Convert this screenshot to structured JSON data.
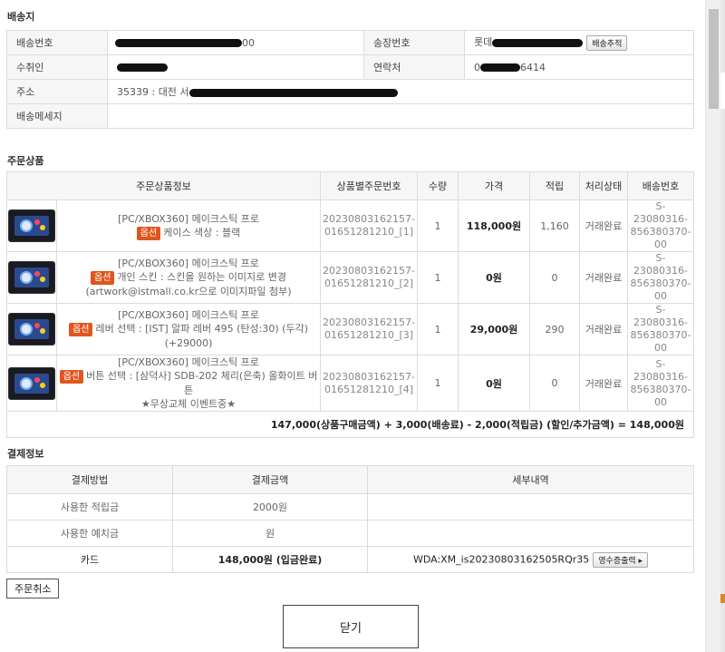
{
  "shipping": {
    "title": "배송지",
    "delivery_no_label": "배송번호",
    "delivery_no_suffix": "00",
    "invoice_label": "송장번호",
    "invoice_prefix": "롯데",
    "track_button": "배송추적",
    "recipient_label": "수취인",
    "contact_label": "연락처",
    "contact_prefix": "0",
    "contact_suffix": "6414",
    "address_label": "주소",
    "address_value": "35339 : 대전 서",
    "message_label": "배송메세지",
    "message_value": ""
  },
  "order": {
    "title": "주문상품",
    "headers": [
      "주문상품정보",
      "상품별주문번호",
      "수량",
      "가격",
      "적립",
      "처리상태",
      "배송번호"
    ],
    "option_badge": "옵션",
    "rows": [
      {
        "product": "[PC/XBOX360] 메이크스틱 프로",
        "option": "케이스 색상 : 블랙",
        "order_no_1": "20230803162157-",
        "order_no_2": "01651281210_[1]",
        "qty": "1",
        "price": "118,000원",
        "points": "1,160",
        "status": "거래완료",
        "ship_1": "S-23080316-",
        "ship_2": "856380370-",
        "ship_3": "00"
      },
      {
        "product": "[PC/XBOX360] 메이크스틱 프로",
        "option": "개인 스킨 : 스킨을 원하는 이미지로 변경",
        "option_2": "(artwork@istmall.co.kr으로 이미지파일 첨부)",
        "order_no_1": "20230803162157-",
        "order_no_2": "01651281210_[2]",
        "qty": "1",
        "price": "0원",
        "points": "0",
        "status": "거래완료",
        "ship_1": "S-23080316-",
        "ship_2": "856380370-",
        "ship_3": "00"
      },
      {
        "product": "[PC/XBOX360] 메이크스틱 프로",
        "option": "레버 선택 : [IST] 알파 레버 495 (탄성:30) (두각)",
        "option_2": "(+29000)",
        "order_no_1": "20230803162157-",
        "order_no_2": "01651281210_[3]",
        "qty": "1",
        "price": "29,000원",
        "points": "290",
        "status": "거래완료",
        "ship_1": "S-23080316-",
        "ship_2": "856380370-",
        "ship_3": "00"
      },
      {
        "product": "[PC/XBOX360] 메이크스틱 프로",
        "option": "버튼 선택 : [삼덕사] SDB-202 체리(은축) 올화이트 버튼",
        "option_2": "★무상교체 이벤트중★",
        "order_no_1": "20230803162157-",
        "order_no_2": "01651281210_[4]",
        "qty": "1",
        "price": "0원",
        "points": "0",
        "status": "거래완료",
        "ship_1": "S-23080316-",
        "ship_2": "856380370-",
        "ship_3": "00"
      }
    ],
    "summary": "147,000(상품구매금액) + 3,000(배송료) - 2,000(적립금) (할인/추가금액) = 148,000원"
  },
  "payment": {
    "title": "결제정보",
    "headers": [
      "결제방법",
      "결제금액",
      "세부내역"
    ],
    "rows": [
      {
        "method": "사용한 적립금",
        "amount": "2000원",
        "detail": ""
      },
      {
        "method": "사용한 예치금",
        "amount": "원",
        "detail": ""
      },
      {
        "method": "카드",
        "amount": "148,000원 (입금완료)",
        "detail": "WDA:XM_is20230803162505RQr35"
      }
    ],
    "receipt_button": "영수증출력 ▸"
  },
  "buttons": {
    "cancel": "주문취소",
    "close": "닫기"
  }
}
